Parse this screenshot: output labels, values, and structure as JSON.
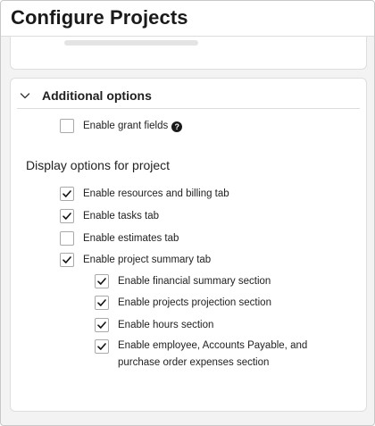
{
  "page": {
    "title": "Configure Projects"
  },
  "additional_options": {
    "heading": "Additional options",
    "enable_grant_fields": {
      "label": "Enable grant fields",
      "checked": false,
      "help_icon": "question-circle-icon"
    }
  },
  "display_options": {
    "heading": "Display options for project",
    "items": [
      {
        "label": "Enable resources and billing tab",
        "checked": true
      },
      {
        "label": "Enable tasks tab",
        "checked": true
      },
      {
        "label": "Enable estimates tab",
        "checked": false
      },
      {
        "label": "Enable project summary tab",
        "checked": true
      }
    ],
    "summary_sub_items": [
      {
        "label": "Enable financial summary section",
        "checked": true
      },
      {
        "label": "Enable projects projection section",
        "checked": true
      },
      {
        "label": "Enable hours section",
        "checked": true
      },
      {
        "label": "Enable employee, Accounts Payable, and purchase order expenses section",
        "checked": true
      }
    ]
  }
}
